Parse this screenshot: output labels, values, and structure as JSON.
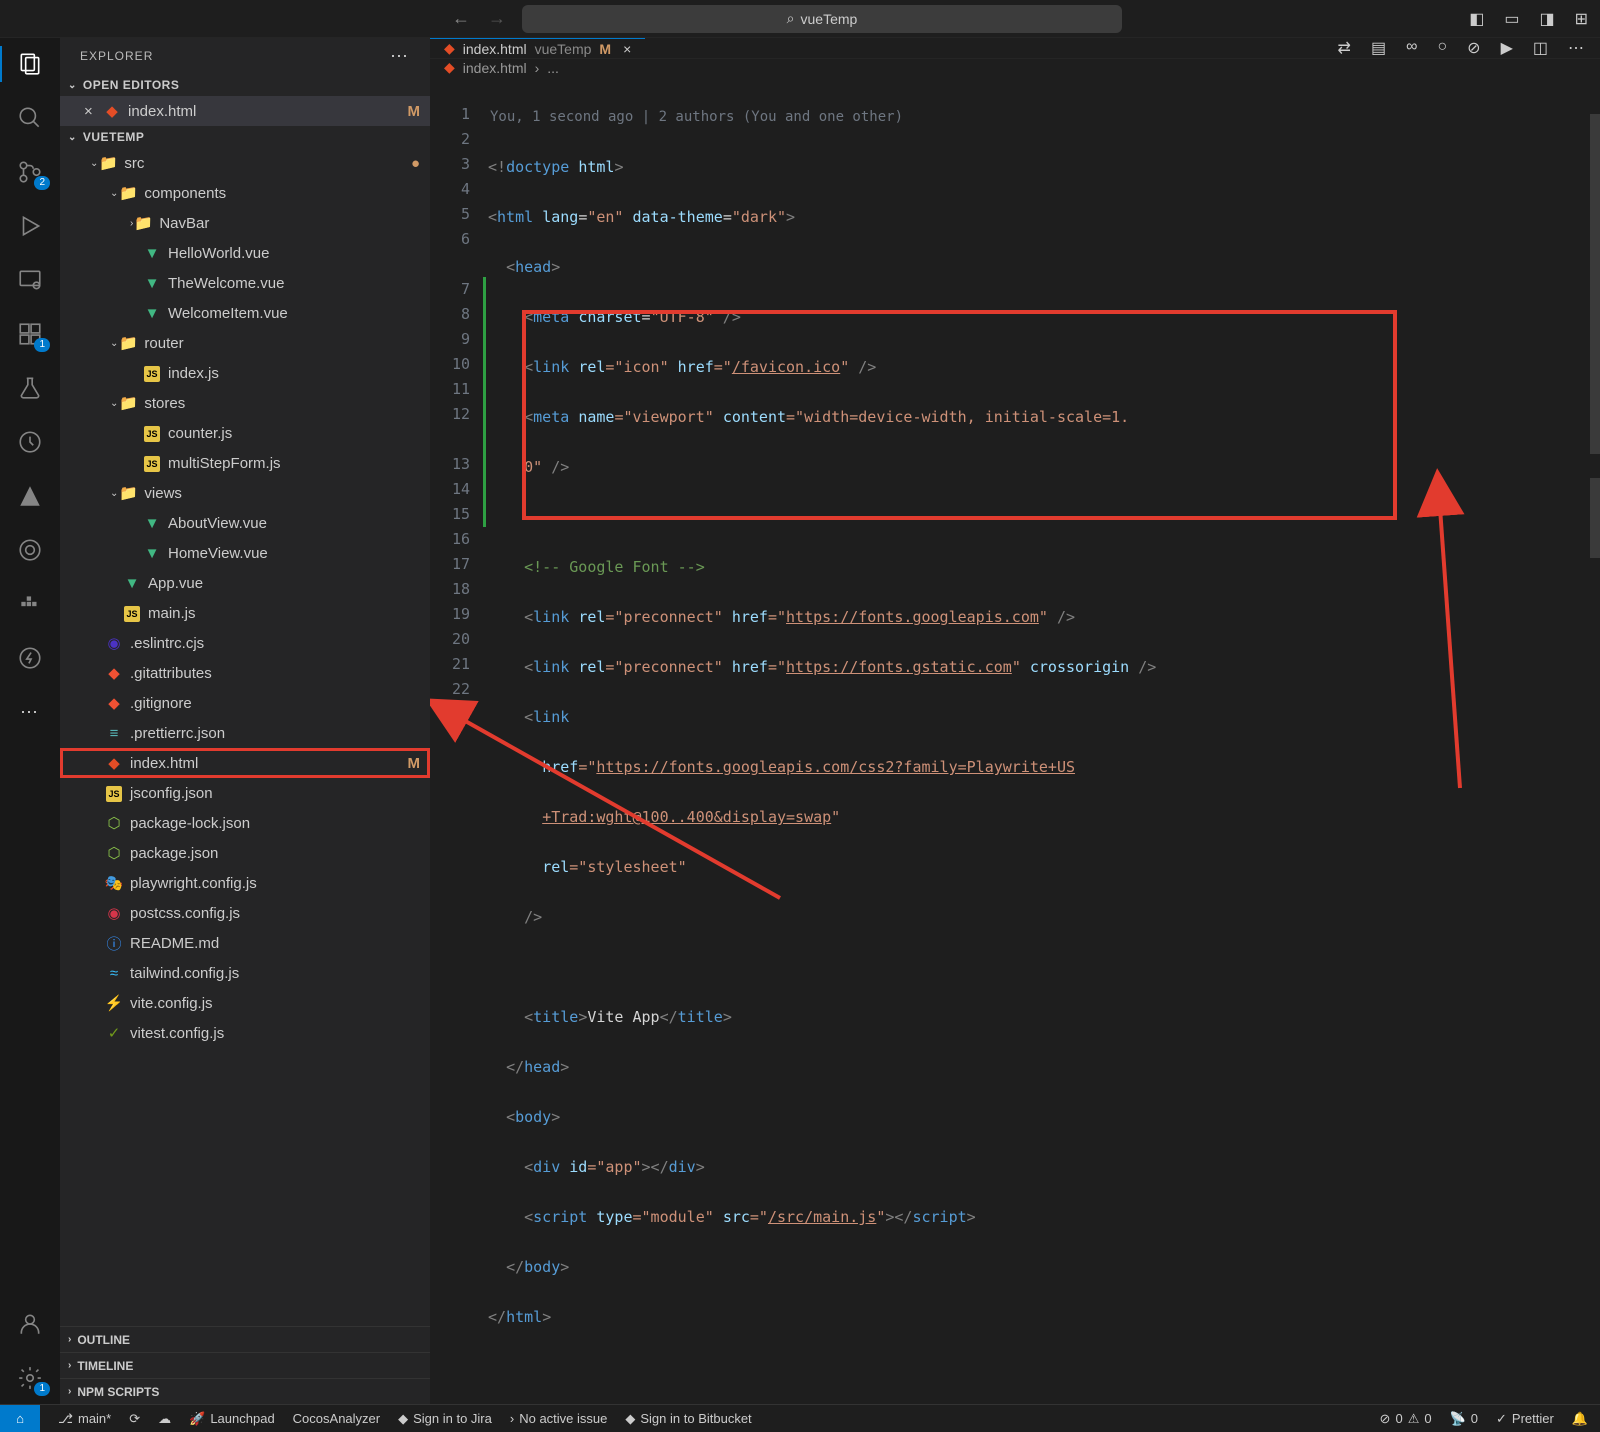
{
  "title_search": "vueTemp",
  "explorer": {
    "title": "EXPLORER",
    "open_editors": "OPEN EDITORS",
    "project": "VUETEMP",
    "outline": "OUTLINE",
    "timeline": "TIMELINE",
    "npm": "NPM SCRIPTS"
  },
  "open_editor_item": {
    "name": "index.html",
    "badge": "M"
  },
  "tree": {
    "src": "src",
    "components": "components",
    "navbar": "NavBar",
    "hello": "HelloWorld.vue",
    "welcome": "TheWelcome.vue",
    "welcomeitem": "WelcomeItem.vue",
    "router": "router",
    "router_index": "index.js",
    "stores": "stores",
    "counter": "counter.js",
    "multistep": "multiStepForm.js",
    "views": "views",
    "about": "AboutView.vue",
    "home": "HomeView.vue",
    "app": "App.vue",
    "main": "main.js",
    "eslint": ".eslintrc.cjs",
    "gitattr": ".gitattributes",
    "gitignore": ".gitignore",
    "prettier": ".prettierrc.json",
    "indexhtml": "index.html",
    "indexhtml_badge": "M",
    "jsconfig": "jsconfig.json",
    "pkglock": "package-lock.json",
    "pkg": "package.json",
    "playwright": "playwright.config.js",
    "postcss": "postcss.config.js",
    "readme": "README.md",
    "tailwind": "tailwind.config.js",
    "vite": "vite.config.js",
    "vitest": "vitest.config.js"
  },
  "tab": {
    "name": "index.html",
    "folder": "vueTemp",
    "badge": "M"
  },
  "breadcrumb": {
    "file": "index.html",
    "more": "..."
  },
  "blame": "You, 1 second ago | 2 authors (You and one other)",
  "code": {
    "l1": {
      "br1": "<!",
      "tag": "doctype ",
      "attr": "html",
      "br2": ">"
    },
    "l2": {
      "br1": "<",
      "tag": "html ",
      "a1": "lang",
      "eq1": "=",
      "s1": "\"en\"",
      "sp": " ",
      "a2": "data-theme",
      "eq2": "=",
      "s2": "\"dark\"",
      "br2": ">"
    },
    "l3": {
      "br1": "<",
      "tag": "head",
      "br2": ">"
    },
    "l4": {
      "br1": "<",
      "tag": "meta ",
      "a1": "charset",
      "eq": "=",
      "s1": "\"UTF-8\"",
      "br2": " />"
    },
    "l5": {
      "br1": "<",
      "tag": "link ",
      "a1": "rel",
      "s1": "=\"icon\" ",
      "a2": "href",
      "eq": "=\"",
      "url": "/favicon.ico",
      "q": "\"",
      "br2": " />"
    },
    "l6": {
      "br1": "<",
      "tag": "meta ",
      "a1": "name",
      "s1": "=\"viewport\" ",
      "a2": "content",
      "s2": "=\"width=device-width, initial-scale=1."
    },
    "l6b": {
      "s": "0\"",
      "br": " />"
    },
    "l8": {
      "cmt": "<!-- Google Font -->"
    },
    "l9": {
      "br1": "<",
      "tag": "link ",
      "a1": "rel",
      "s1": "=\"preconnect\" ",
      "a2": "href",
      "eq": "=\"",
      "url": "https://fonts.googleapis.com",
      "q": "\"",
      "br2": " />"
    },
    "l10": {
      "br1": "<",
      "tag": "link ",
      "a1": "rel",
      "s1": "=\"preconnect\" ",
      "a2": "href",
      "eq": "=\"",
      "url": "https://fonts.gstatic.com",
      "q": "\" ",
      "a3": "crossorigin",
      "br2": " />"
    },
    "l11": {
      "br1": "<",
      "tag": "link"
    },
    "l12": {
      "a1": "href",
      "eq": "=\"",
      "url": "https://fonts.googleapis.com/css2?family=Playwrite+US"
    },
    "l12b": {
      "url": "+Trad:wght@100..400&display=swap",
      "q": "\""
    },
    "l13": {
      "a1": "rel",
      "s1": "=\"stylesheet\""
    },
    "l14": {
      "br": "/>"
    },
    "l16": {
      "br1": "<",
      "tag": "title",
      "br2": ">",
      "txt": "Vite App",
      "br3": "</",
      "tag2": "title",
      "br4": ">"
    },
    "l17": {
      "br1": "</",
      "tag": "head",
      "br2": ">"
    },
    "l18": {
      "br1": "<",
      "tag": "body",
      "br2": ">"
    },
    "l19": {
      "br1": "<",
      "tag": "div ",
      "a1": "id",
      "s1": "=\"app\"",
      "br2": "></",
      "tag2": "div",
      "br3": ">"
    },
    "l20": {
      "br1": "<",
      "tag": "script ",
      "a1": "type",
      "s1": "=\"module\" ",
      "a2": "src",
      "eq": "=\"",
      "url": "/src/main.js",
      "q": "\"",
      "br2": "></",
      "tag2": "script",
      "br3": ">"
    },
    "l21": {
      "br1": "</",
      "tag": "body",
      "br2": ">"
    },
    "l22": {
      "br1": "</",
      "tag": "html",
      "br2": ">"
    }
  },
  "status": {
    "branch": "main*",
    "launchpad": "Launchpad",
    "cocos": "CocosAnalyzer",
    "jira": "Sign in to Jira",
    "issue": "No active issue",
    "bitbucket": "Sign in to Bitbucket",
    "err": "0",
    "warn": "0",
    "port": "0",
    "prettier": "Prettier"
  },
  "badges": {
    "scm": "2",
    "ext": "1",
    "gear": "1"
  }
}
